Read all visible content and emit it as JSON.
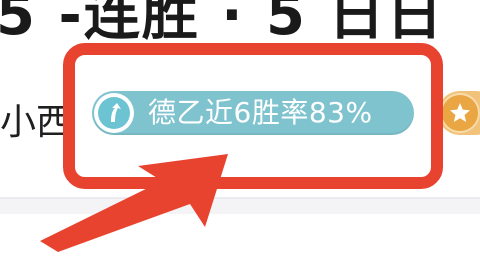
{
  "headline": {
    "text": "5 -连胜 · 5 日日"
  },
  "match_row": {
    "team_name": "小西",
    "stat_badge": {
      "text": "德乙近6胜率83%",
      "icon": "trend-up-arrow-icon",
      "color": "#7fc3cf"
    },
    "next_badge": {
      "icon": "star-icon",
      "color": "#e9a642"
    }
  },
  "annotation": {
    "box_color": "#e8432f",
    "arrow_color": "#e8432f"
  }
}
